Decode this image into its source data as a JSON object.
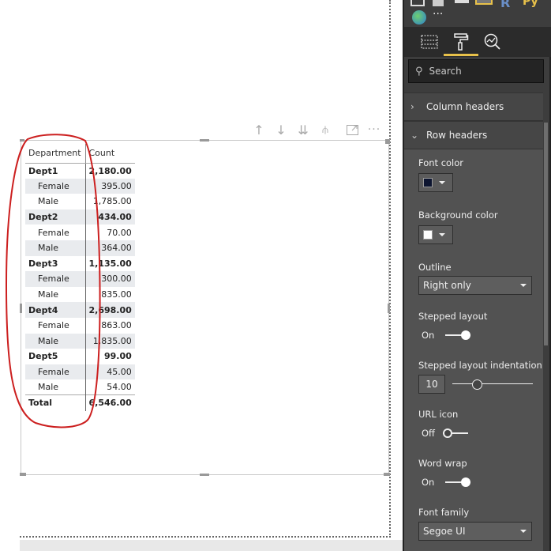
{
  "visual_header": {
    "icons": [
      "drill-up-icon",
      "drill-down-icon",
      "go-to-next-level-icon",
      "expand-hierarchy-icon",
      "focus-mode-icon",
      "more-options-icon"
    ]
  },
  "matrix": {
    "columns": [
      "Department",
      "Count"
    ],
    "rows": [
      {
        "label": "Dept1",
        "value": "2,180.00",
        "level": 1
      },
      {
        "label": "Female",
        "value": "395.00",
        "level": 2
      },
      {
        "label": "Male",
        "value": "1,785.00",
        "level": 2
      },
      {
        "label": "Dept2",
        "value": "434.00",
        "level": 1
      },
      {
        "label": "Female",
        "value": "70.00",
        "level": 2
      },
      {
        "label": "Male",
        "value": "364.00",
        "level": 2
      },
      {
        "label": "Dept3",
        "value": "1,135.00",
        "level": 1
      },
      {
        "label": "Female",
        "value": "300.00",
        "level": 2
      },
      {
        "label": "Male",
        "value": "835.00",
        "level": 2
      },
      {
        "label": "Dept4",
        "value": "2,698.00",
        "level": 1
      },
      {
        "label": "Female",
        "value": "863.00",
        "level": 2
      },
      {
        "label": "Male",
        "value": "1,835.00",
        "level": 2
      },
      {
        "label": "Dept5",
        "value": "99.00",
        "level": 1
      },
      {
        "label": "Female",
        "value": "45.00",
        "level": 2
      },
      {
        "label": "Male",
        "value": "54.00",
        "level": 2
      }
    ],
    "total": {
      "label": "Total",
      "value": "6,546.00"
    }
  },
  "panel": {
    "tabs": [
      {
        "name": "fields-tab",
        "icon": "fields-icon"
      },
      {
        "name": "format-tab",
        "icon": "paint-roller-icon",
        "active": true
      },
      {
        "name": "analytics-tab",
        "icon": "analytics-icon"
      }
    ],
    "search_placeholder": "Search",
    "sections": {
      "column_headers": "Column headers",
      "row_headers": "Row headers"
    },
    "font_color": {
      "label": "Font color",
      "value": "#0d1530"
    },
    "background_color": {
      "label": "Background color",
      "value": "#ffffff"
    },
    "outline": {
      "label": "Outline",
      "value": "Right only"
    },
    "stepped_layout": {
      "label": "Stepped layout",
      "state": "On",
      "on": true
    },
    "stepped_indentation": {
      "label": "Stepped layout indentation",
      "value": "10",
      "fraction": 0.28
    },
    "url_icon": {
      "label": "URL icon",
      "state": "Off",
      "on": false
    },
    "word_wrap": {
      "label": "Word wrap",
      "state": "On",
      "on": true
    },
    "font_family": {
      "label": "Font family",
      "value": "Segoe UI"
    },
    "more_visuals": "···"
  },
  "colors": {
    "accent": "#e8c14a",
    "annotation": "#cc1f1f",
    "panel_bg": "#525252"
  }
}
